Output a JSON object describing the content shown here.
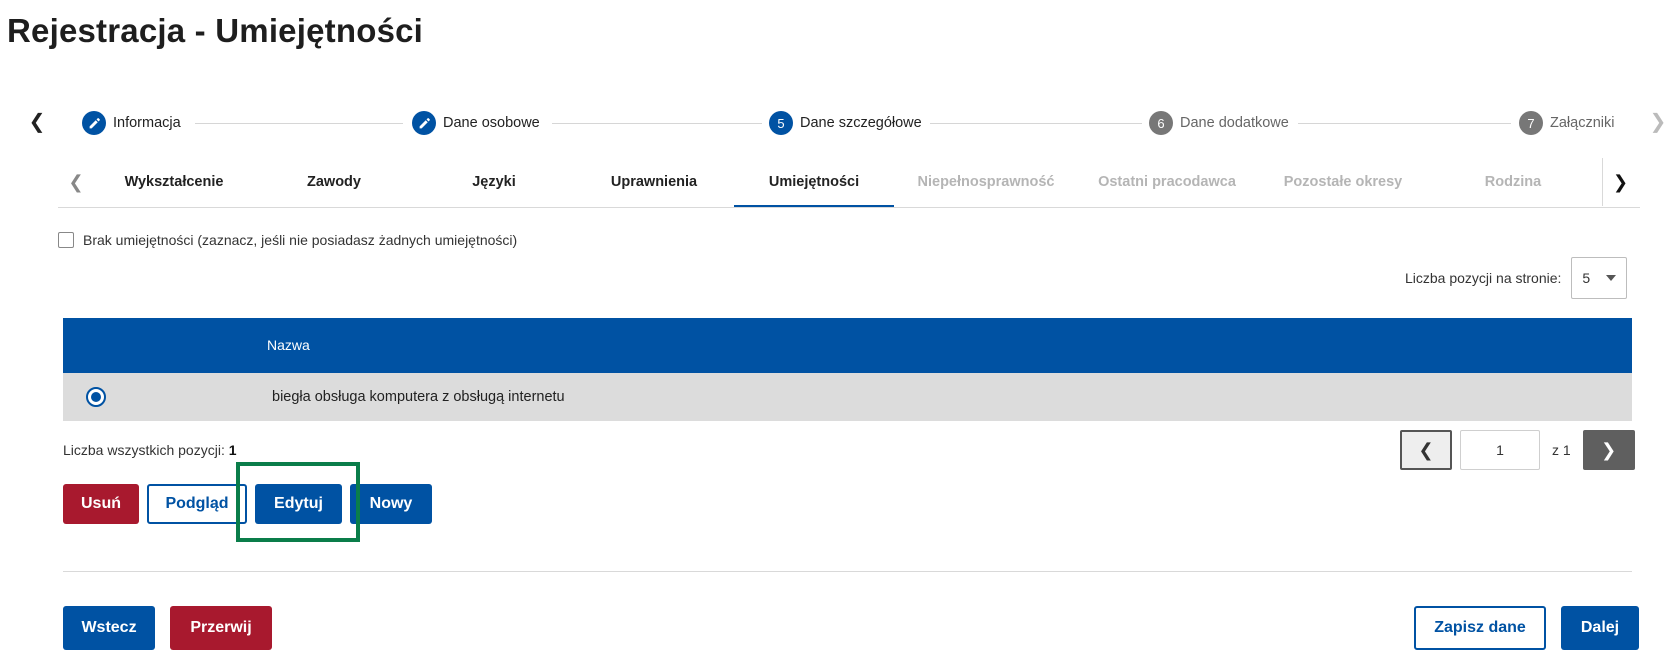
{
  "page": {
    "title": "Rejestracja - Umiejętności"
  },
  "stepper": {
    "steps": [
      {
        "num": "",
        "label": "Informacja",
        "state": "done",
        "icon": "pencil-icon"
      },
      {
        "num": "",
        "label": "Dane osobowe",
        "state": "done",
        "icon": "pencil-icon"
      },
      {
        "num": "5",
        "label": "Dane szczegółowe",
        "state": "active"
      },
      {
        "num": "6",
        "label": "Dane dodatkowe",
        "state": "todo"
      },
      {
        "num": "7",
        "label": "Załączniki",
        "state": "todo"
      }
    ]
  },
  "tabs": {
    "items": [
      {
        "label": "Wykształcenie",
        "state": "enabled"
      },
      {
        "label": "Zawody",
        "state": "enabled"
      },
      {
        "label": "Języki",
        "state": "enabled"
      },
      {
        "label": "Uprawnienia",
        "state": "enabled"
      },
      {
        "label": "Umiejętności",
        "state": "active"
      },
      {
        "label": "Niepełnosprawność",
        "state": "disabled"
      },
      {
        "label": "Ostatni pracodawca",
        "state": "disabled"
      },
      {
        "label": "Pozostałe okresy",
        "state": "disabled"
      },
      {
        "label": "Rodzina",
        "state": "disabled"
      }
    ]
  },
  "no_skills": {
    "label": "Brak umiejętności (zaznacz, jeśli nie posiadasz żadnych umiejętności)",
    "checked": false
  },
  "page_size": {
    "label": "Liczba pozycji na stronie:",
    "value": "5"
  },
  "table": {
    "columns": [
      "Nazwa"
    ],
    "rows": [
      {
        "selected": true,
        "name": "biegła obsługa komputera z obsługą internetu"
      }
    ]
  },
  "total": {
    "label": "Liczba wszystkich pozycji:",
    "value": "1"
  },
  "pager": {
    "current": "1",
    "of_label": "z 1"
  },
  "actions": {
    "delete": "Usuń",
    "preview": "Podgląd",
    "edit": "Edytuj",
    "new": "Nowy"
  },
  "footer": {
    "back": "Wstecz",
    "abort": "Przerwij",
    "save": "Zapisz dane",
    "next": "Dalej"
  },
  "colors": {
    "primary": "#0052a3",
    "danger": "#a8192e",
    "highlight": "#0a7d4a"
  }
}
